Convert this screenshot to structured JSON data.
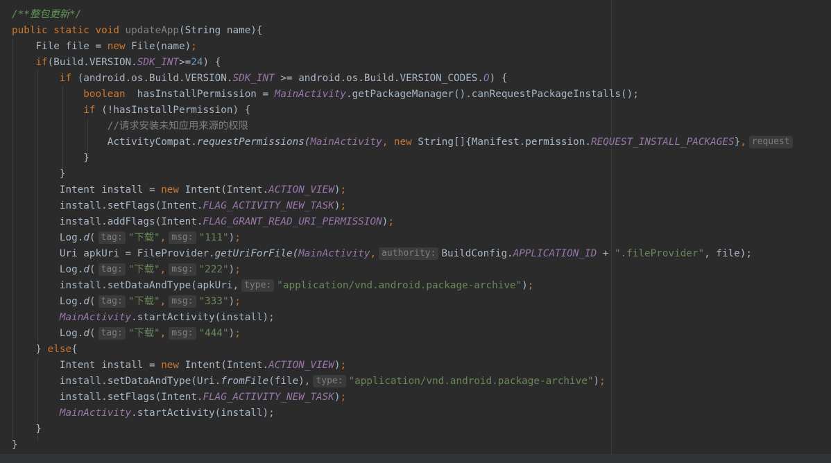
{
  "colors": {
    "background": "#2b2b2b",
    "default_text": "#a9b7c6",
    "keyword": "#cc7832",
    "doc_comment": "#629755",
    "line_comment": "#808080",
    "number": "#6897bb",
    "string": "#6a8759",
    "static_field": "#9876aa",
    "param_hint_bg": "#3b3b3b"
  },
  "hints": {
    "tag": "tag:",
    "msg": "msg:",
    "authority": "authority:",
    "type": "type:",
    "request": "request"
  },
  "code": {
    "l1": "/**整包更新*/",
    "l3_class": "Build.VERSION.",
    "l3_field": "SDK_INT",
    "l3_num": "24",
    "l4_a": "(android.os.Build.VERSION.",
    "l4_field": "SDK_INT",
    "l4_b": " >= android.os.Build.VERSION_CODES.",
    "l4_o": "O",
    "l5_var": "hasInstallPermission = ",
    "l5_act": "MainActivity",
    "l5_rest": ".getPackageManager().canRequestPackageInstalls();",
    "l6_cond": "(!hasInstallPermission) {",
    "l7_comment": "//请求安装未知应用来源的权限",
    "l8_class": "ActivityCompat.",
    "l8_method": "requestPermissions",
    "l8_act": "MainActivity",
    "l8_arr": " String[]{Manifest.permission.",
    "l8_perm": "REQUEST_INSTALL_PACKAGES",
    "l11_a": "Intent install = ",
    "l11_b": " Intent(Intent.",
    "l11_c": "ACTION_VIEW",
    "l12_a": "install.setFlags(Intent.",
    "l12_b": "FLAG_ACTIVITY_NEW_TASK",
    "l13_a": "install.addFlags(Intent.",
    "l13_b": "FLAG_GRANT_READ_URI_PERMISSION",
    "log_prefix": "Log.",
    "log_method": "d",
    "log_tag": "\"下载\"",
    "log_111": "\"111\"",
    "log_222": "\"222\"",
    "log_333": "\"333\"",
    "log_444": "\"444\"",
    "l15_a": "Uri apkUri = FileProvider.",
    "l15_method": "getUriForFile",
    "l15_act": "MainActivity",
    "l15_b": "BuildConfig.",
    "l15_const": "APPLICATION_ID",
    "l15_str": "\".fileProvider\"",
    "l15_end": ", file);",
    "l17_a": "install.setDataAndType(apkUri,",
    "mime": "\"application/vnd.android.package-archive\"",
    "l19_act": "MainActivity",
    "l19_rest": ".startActivity(install);",
    "l22_a": "install.setDataAndType(Uri.",
    "l22_method": "fromFile",
    "l22_b": "(file),"
  }
}
